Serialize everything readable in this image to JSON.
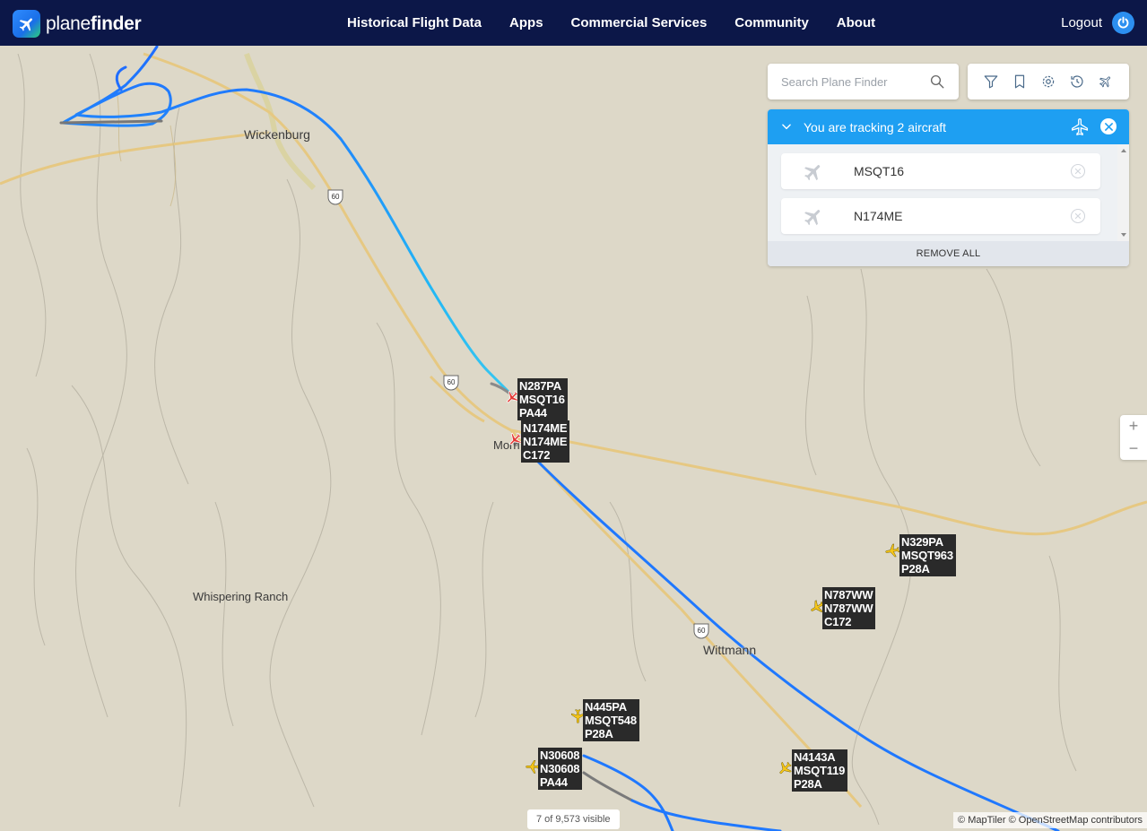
{
  "header": {
    "brand_plain": "plane",
    "brand_bold": "finder",
    "nav": [
      "Historical Flight Data",
      "Apps",
      "Commercial Services",
      "Community",
      "About"
    ],
    "logout_label": "Logout"
  },
  "search": {
    "placeholder": "Search Plane Finder"
  },
  "toolbar": {
    "icons": [
      "filter-icon",
      "bookmark-icon",
      "settings-icon",
      "history-icon",
      "3d-view-icon"
    ]
  },
  "tracking": {
    "title": "You are tracking 2 aircraft",
    "aircraft": [
      "MSQT16",
      "N174ME"
    ],
    "remove_all_label": "REMOVE ALL"
  },
  "map": {
    "places": {
      "wickenburg": "Wickenburg",
      "morristown": "Morri",
      "whispering_ranch": "Whispering Ranch",
      "wittmann": "Wittmann"
    },
    "route_shield": "60",
    "aircraft": [
      {
        "reg": "N287PA",
        "callsign": "MSQT16",
        "type": "PA44"
      },
      {
        "reg": "N174ME",
        "callsign": "N174ME",
        "type": "C172"
      },
      {
        "reg": "N329PA",
        "callsign": "MSQT963",
        "type": "P28A"
      },
      {
        "reg": "N787WW",
        "callsign": "N787WW",
        "type": "C172"
      },
      {
        "reg": "N445PA",
        "callsign": "MSQT548",
        "type": "P28A"
      },
      {
        "reg": "N30608",
        "callsign": "N30608",
        "type": "PA44"
      },
      {
        "reg": "N4143A",
        "callsign": "MSQT119",
        "type": "P28A"
      }
    ],
    "colors": {
      "track": "#1f78ff",
      "track_light": "#22b8f5",
      "highway": "#e6c882",
      "land": "#ddd8c8",
      "aircraft_selected": "#e53935",
      "aircraft": "#f5c518"
    }
  },
  "zoom": {
    "in": "+",
    "out": "−"
  },
  "status": {
    "visible_count": "7 of 9,573 visible"
  },
  "attribution": "© MapTiler © OpenStreetMap contributors"
}
